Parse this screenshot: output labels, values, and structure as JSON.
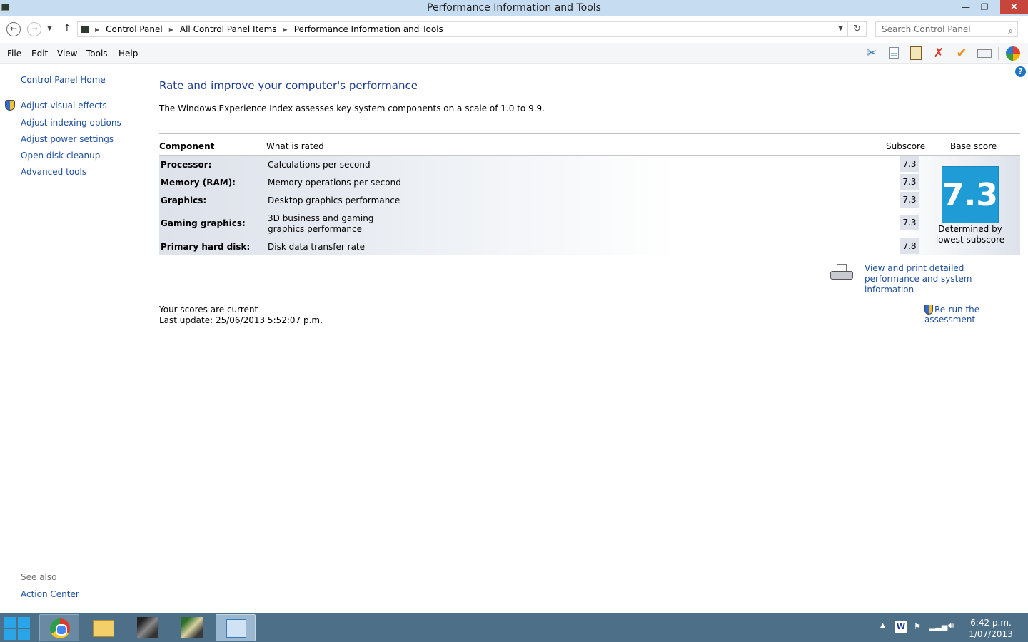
{
  "window": {
    "title": "Performance Information and Tools",
    "minimize": "—",
    "maximize": "❐",
    "close": "✕"
  },
  "address": {
    "crumbs": [
      "Control Panel",
      "All Control Panel Items",
      "Performance Information and Tools"
    ],
    "search_placeholder": "Search Control Panel"
  },
  "menu": {
    "file": "File",
    "edit": "Edit",
    "view": "View",
    "tools": "Tools",
    "help": "Help"
  },
  "sidebar": {
    "home": "Control Panel Home",
    "links": [
      "Adjust visual effects",
      "Adjust indexing options",
      "Adjust power settings",
      "Open disk cleanup",
      "Advanced tools"
    ],
    "see_also_label": "See also",
    "see_also_links": [
      "Action Center"
    ]
  },
  "main": {
    "heading": "Rate and improve your computer's performance",
    "description": "The Windows Experience Index assesses key system components on a scale of 1.0 to 9.9.",
    "table": {
      "headers": {
        "component": "Component",
        "what": "What is rated",
        "subscore": "Subscore",
        "base": "Base score"
      },
      "rows": [
        {
          "component": "Processor:",
          "what": "Calculations per second",
          "subscore": "7.3"
        },
        {
          "component": "Memory (RAM):",
          "what": "Memory operations per second",
          "subscore": "7.3"
        },
        {
          "component": "Graphics:",
          "what": "Desktop graphics performance",
          "subscore": "7.3"
        },
        {
          "component": "Gaming graphics:",
          "what": "3D business and gaming graphics performance",
          "subscore": "7.3"
        },
        {
          "component": "Primary hard disk:",
          "what": "Disk data transfer rate",
          "subscore": "7.8"
        }
      ],
      "base_score": "7.3",
      "base_caption": "Determined by lowest subscore"
    },
    "print_link": "View and print detailed performance and system information",
    "scores_status": "Your scores are current",
    "last_update": "Last update: 25/06/2013 5:52:07 p.m.",
    "rerun_link": "Re-run the assessment"
  },
  "taskbar": {
    "tray_keyboard": "W",
    "clock_time": "6:42 p.m.",
    "clock_date": "1/07/2013"
  }
}
